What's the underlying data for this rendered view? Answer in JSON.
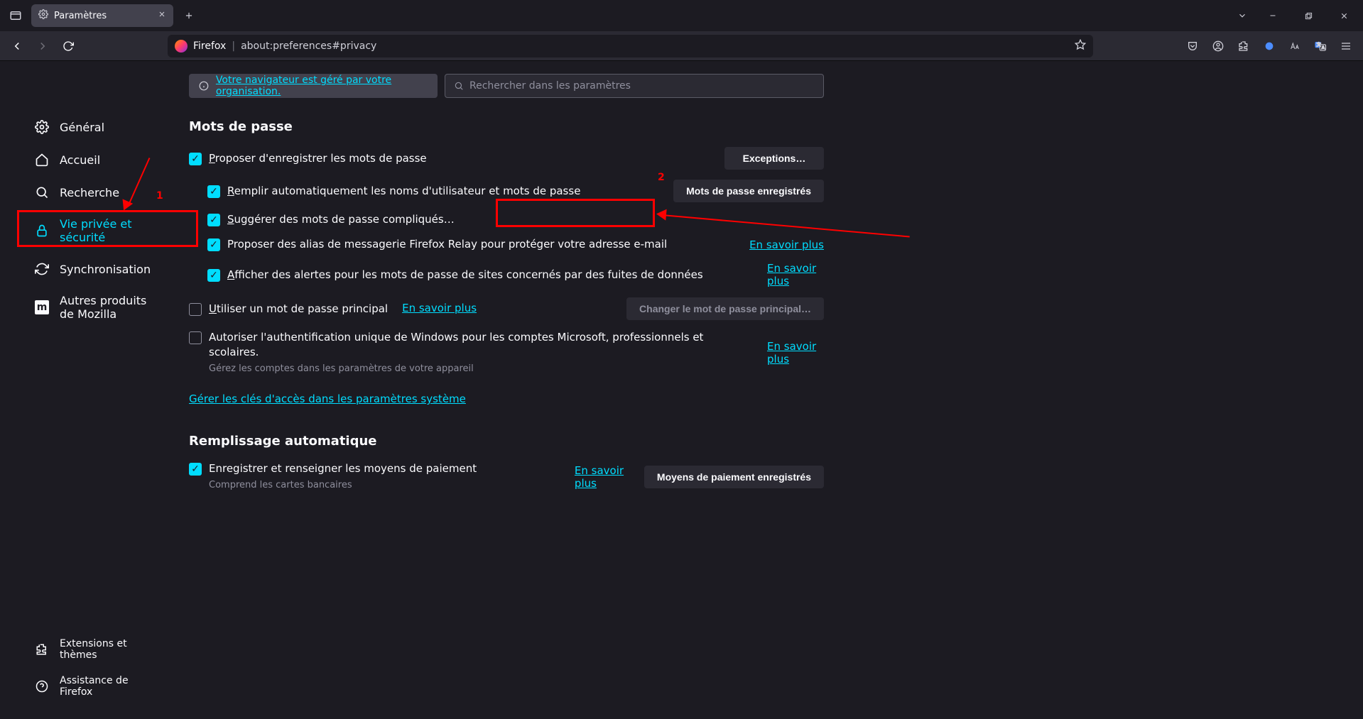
{
  "tab": {
    "title": "Paramètres"
  },
  "urlbar": {
    "brand": "Firefox",
    "address": "about:preferences#privacy"
  },
  "sidebar": {
    "items": [
      {
        "label": "Général"
      },
      {
        "label": "Accueil"
      },
      {
        "label": "Recherche"
      },
      {
        "label": "Vie privée et sécurité"
      },
      {
        "label": "Synchronisation"
      },
      {
        "label": "Autres produits de Mozilla"
      }
    ],
    "bottom": [
      {
        "label": "Extensions et thèmes"
      },
      {
        "label": "Assistance de Firefox"
      }
    ]
  },
  "info": {
    "org_link": "Votre navigateur est géré par votre organisation."
  },
  "search": {
    "placeholder": "Rechercher dans les paramètres"
  },
  "passwords": {
    "title": "Mots de passe",
    "save_prompt": "Proposer d'enregistrer les mots de passe",
    "exceptions_btn": "Exceptions…",
    "autofill": "Remplir automatiquement les noms d'utilisateur et mots de passe",
    "saved_btn": "Mots de passe enregistrés",
    "suggest_strong": "Suggérer des mots de passe compliqués…",
    "relay": "Proposer des alias de messagerie Firefox Relay pour protéger votre adresse e-mail",
    "learn_more": "En savoir plus",
    "breach": "Afficher des alertes pour les mots de passe de sites concernés par des fuites de données",
    "primary_pw": "Utiliser un mot de passe principal",
    "change_primary_btn": "Changer le mot de passe principal…",
    "windows_sso": "Autoriser l'authentification unique de Windows pour les comptes Microsoft, professionnels et scolaires.",
    "windows_sso_sub": "Gérez les comptes dans les paramètres de votre appareil",
    "manage_keys": "Gérer les clés d'accès dans les paramètres système"
  },
  "autofill": {
    "title": "Remplissage automatique",
    "payment": "Enregistrer et renseigner les moyens de paiement",
    "payment_sub": "Comprend les cartes bancaires",
    "saved_payment_btn": "Moyens de paiement enregistrés"
  },
  "annotations": {
    "n1": "1",
    "n2": "2"
  }
}
